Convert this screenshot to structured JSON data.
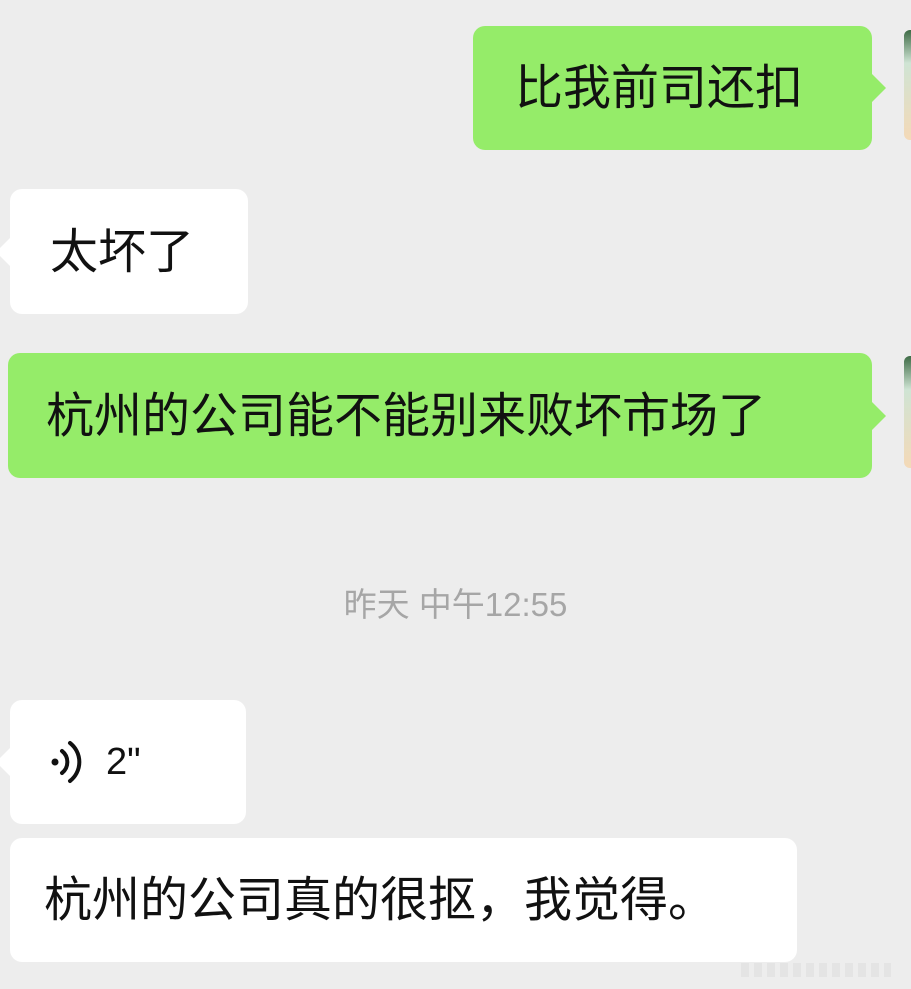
{
  "chat": {
    "messages": [
      {
        "direction": "out",
        "type": "text",
        "text": "比我前司还扣"
      },
      {
        "direction": "in",
        "type": "text",
        "text": "太坏了"
      },
      {
        "direction": "out",
        "type": "text",
        "text": "杭州的公司能不能别来败坏市场了"
      },
      {
        "direction": "in",
        "type": "voice",
        "duration": "2\"",
        "icon": "voice-wave-icon"
      },
      {
        "direction": "in",
        "type": "text",
        "text": "杭州的公司真的很抠，我觉得。"
      }
    ],
    "timestamp": "昨天 中午12:55"
  },
  "colors": {
    "background": "#ededed",
    "outgoing_bubble": "#95ec69",
    "incoming_bubble": "#ffffff",
    "timestamp_text": "#a6a6a6"
  }
}
